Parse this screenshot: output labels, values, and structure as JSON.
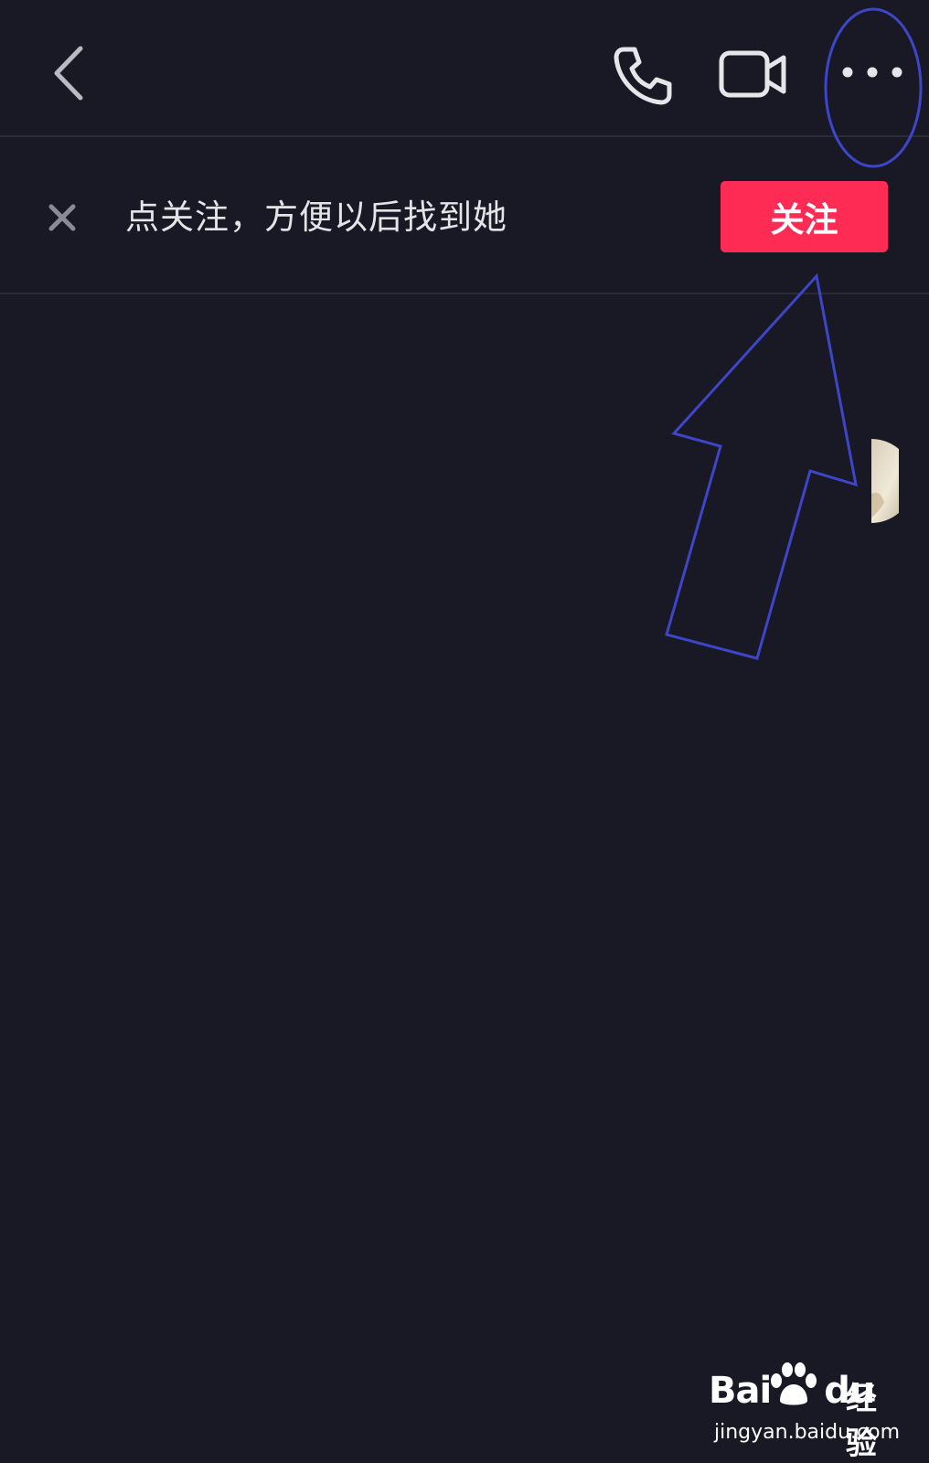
{
  "header": {
    "icons": {
      "back": "chevron-left-icon",
      "phone": "phone-icon",
      "video": "video-camera-icon",
      "more": "more-dots-icon"
    }
  },
  "follow_prompt": {
    "close_icon": "close-icon",
    "text": "点关注，方便以后找到她",
    "button_label": "关注",
    "button_color": "#fe2c55"
  },
  "colors": {
    "background": "#181924",
    "annotation": "#3d45c8"
  },
  "watermark": {
    "brand_prefix": "Bai",
    "brand_suffix": "du",
    "brand_cn": "经验",
    "url": "jingyan.baidu.com"
  }
}
